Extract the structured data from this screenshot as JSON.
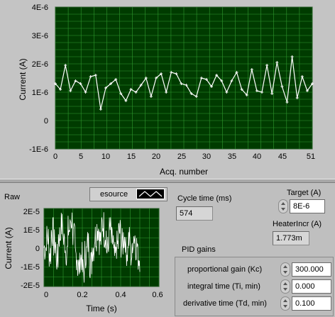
{
  "top_chart": {
    "ylabel": "Current (A)",
    "xlabel": "Acq. number",
    "x_ticks": [
      "0",
      "5",
      "10",
      "15",
      "20",
      "25",
      "30",
      "35",
      "40",
      "45",
      "51"
    ],
    "y_ticks": [
      "4E-6",
      "3E-6",
      "2E-6",
      "1E-6",
      "0",
      "-1E-6"
    ]
  },
  "raw_chart": {
    "title": "Raw",
    "ylabel": "Current (A)",
    "xlabel": "Time (s)",
    "x_ticks": [
      "0",
      "0.2",
      "0.4",
      "0.6"
    ],
    "y_ticks": [
      "2E-5",
      "1E-5",
      "0",
      "-1E-5",
      "-2E-5"
    ]
  },
  "esource": {
    "label": "esource"
  },
  "cycle_time": {
    "label": "Cycle time (ms)",
    "value": "574"
  },
  "target": {
    "label": "Target (A)",
    "value": "8E-6"
  },
  "heater": {
    "label": "HeaterIncr (A)",
    "value": "1.773m"
  },
  "pid": {
    "label": "PID gains",
    "kc_label": "proportional gain (Kc)",
    "kc_value": "300.000",
    "ti_label": "integral time (Ti, min)",
    "ti_value": "0.000",
    "td_label": "derivative time (Td, min)",
    "td_value": "0.100"
  },
  "colors": {
    "plot_bg": "#003b00",
    "grid": "#2f9a2f",
    "trace": "#ffffff",
    "panel": "#c4c4c4"
  },
  "chart_data": [
    {
      "type": "line",
      "x": [
        0,
        1,
        2,
        3,
        4,
        5,
        6,
        7,
        8,
        9,
        10,
        11,
        12,
        13,
        14,
        15,
        16,
        17,
        18,
        19,
        20,
        21,
        22,
        23,
        24,
        25,
        26,
        27,
        28,
        29,
        30,
        31,
        32,
        33,
        34,
        35,
        36,
        37,
        38,
        39,
        40,
        41,
        42,
        43,
        44,
        45,
        46,
        47,
        48,
        49,
        50,
        51
      ],
      "series": [
        {
          "values": [
            1.3e-06,
            1.1e-06,
            1.95e-06,
            1.05e-06,
            1.4e-06,
            1.3e-06,
            1e-06,
            1.55e-06,
            1.6e-06,
            4e-07,
            1.15e-06,
            1.3e-06,
            1.45e-06,
            9.5e-07,
            7e-07,
            1.1e-06,
            1e-06,
            1.25e-06,
            1.5e-06,
            8.5e-07,
            1.5e-06,
            1.65e-06,
            1e-06,
            1.7e-06,
            1.65e-06,
            1.3e-06,
            1.25e-06,
            9.5e-07,
            8.5e-07,
            1.5e-06,
            1.45e-06,
            1.2e-06,
            1.6e-06,
            1.4e-06,
            1e-06,
            1.4e-06,
            1.7e-06,
            1.1e-06,
            9e-07,
            1.8e-06,
            1.05e-06,
            1e-06,
            1.95e-06,
            9.5e-07,
            2.05e-06,
            1.2e-06,
            6.5e-07,
            2.25e-06,
            8e-07,
            1.55e-06,
            1.05e-06,
            1.3e-06
          ]
        }
      ],
      "xlabel": "Acq. number",
      "ylabel": "Current (A)",
      "xlim": [
        0,
        51
      ],
      "ylim": [
        -1e-06,
        4e-06
      ],
      "grid": true
    },
    {
      "type": "line",
      "title": "Raw",
      "series": [
        {
          "values": [
            0.0,
            5e-06,
            -3e-06,
            8e-06,
            2e-06,
            -6e-06,
            6e-06,
            1.1e-05,
            3e-06,
            -2e-06,
            9e-06,
            1.4e-05,
            5e-06,
            -4e-06,
            -1e-05,
            -5e-06,
            -1.2e-05,
            -3e-06,
            2e-06,
            -8e-06,
            0.0,
            6e-06,
            1e-05,
            4e-06,
            1.2e-05,
            7e-06,
            -1e-06,
            9e-06,
            3e-06,
            -5e-06,
            1e-06,
            8e-06,
            2e-06,
            5e-06,
            -2e-06,
            4e-06,
            -4e-06,
            6e-06,
            1e-06,
            -5e-06
          ]
        }
      ],
      "xlim": [
        0,
        0.6
      ],
      "ylim": [
        -2e-05,
        2e-05
      ],
      "data_xrange": [
        0,
        0.5
      ],
      "xlabel": "Time (s)",
      "ylabel": "Current (A)",
      "grid": true
    }
  ]
}
